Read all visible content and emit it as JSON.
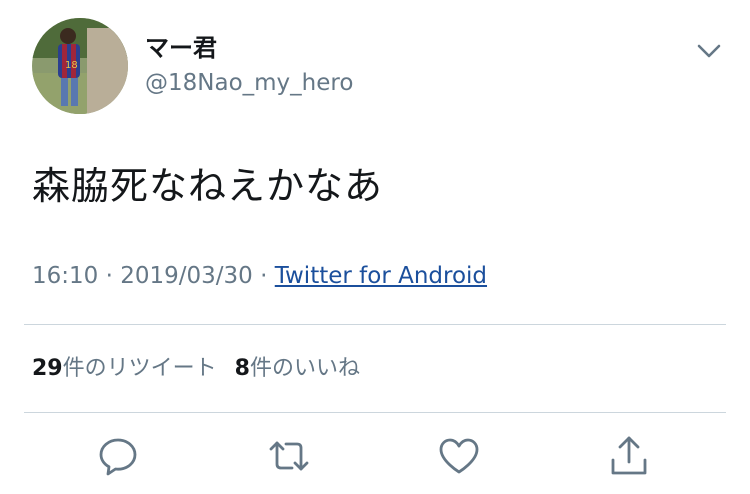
{
  "tweet": {
    "display_name": "マー君",
    "handle": "@18Nao_my_hero",
    "text": "森脇死なねえかなあ",
    "time": "16:10",
    "date": "2019/03/30",
    "separator": "·",
    "source": "Twitter for Android"
  },
  "stats": {
    "retweets_count": "29",
    "retweets_label": "件のリツイート",
    "likes_count": "8",
    "likes_label": "件のいいね"
  },
  "icons": {
    "menu": "chevron-down-icon",
    "reply": "reply-icon",
    "retweet": "retweet-icon",
    "like": "heart-icon",
    "share": "share-icon"
  },
  "colors": {
    "text": "#14171a",
    "secondary": "#657786",
    "link": "#1b4f9c",
    "divider": "#ccd6dd"
  }
}
